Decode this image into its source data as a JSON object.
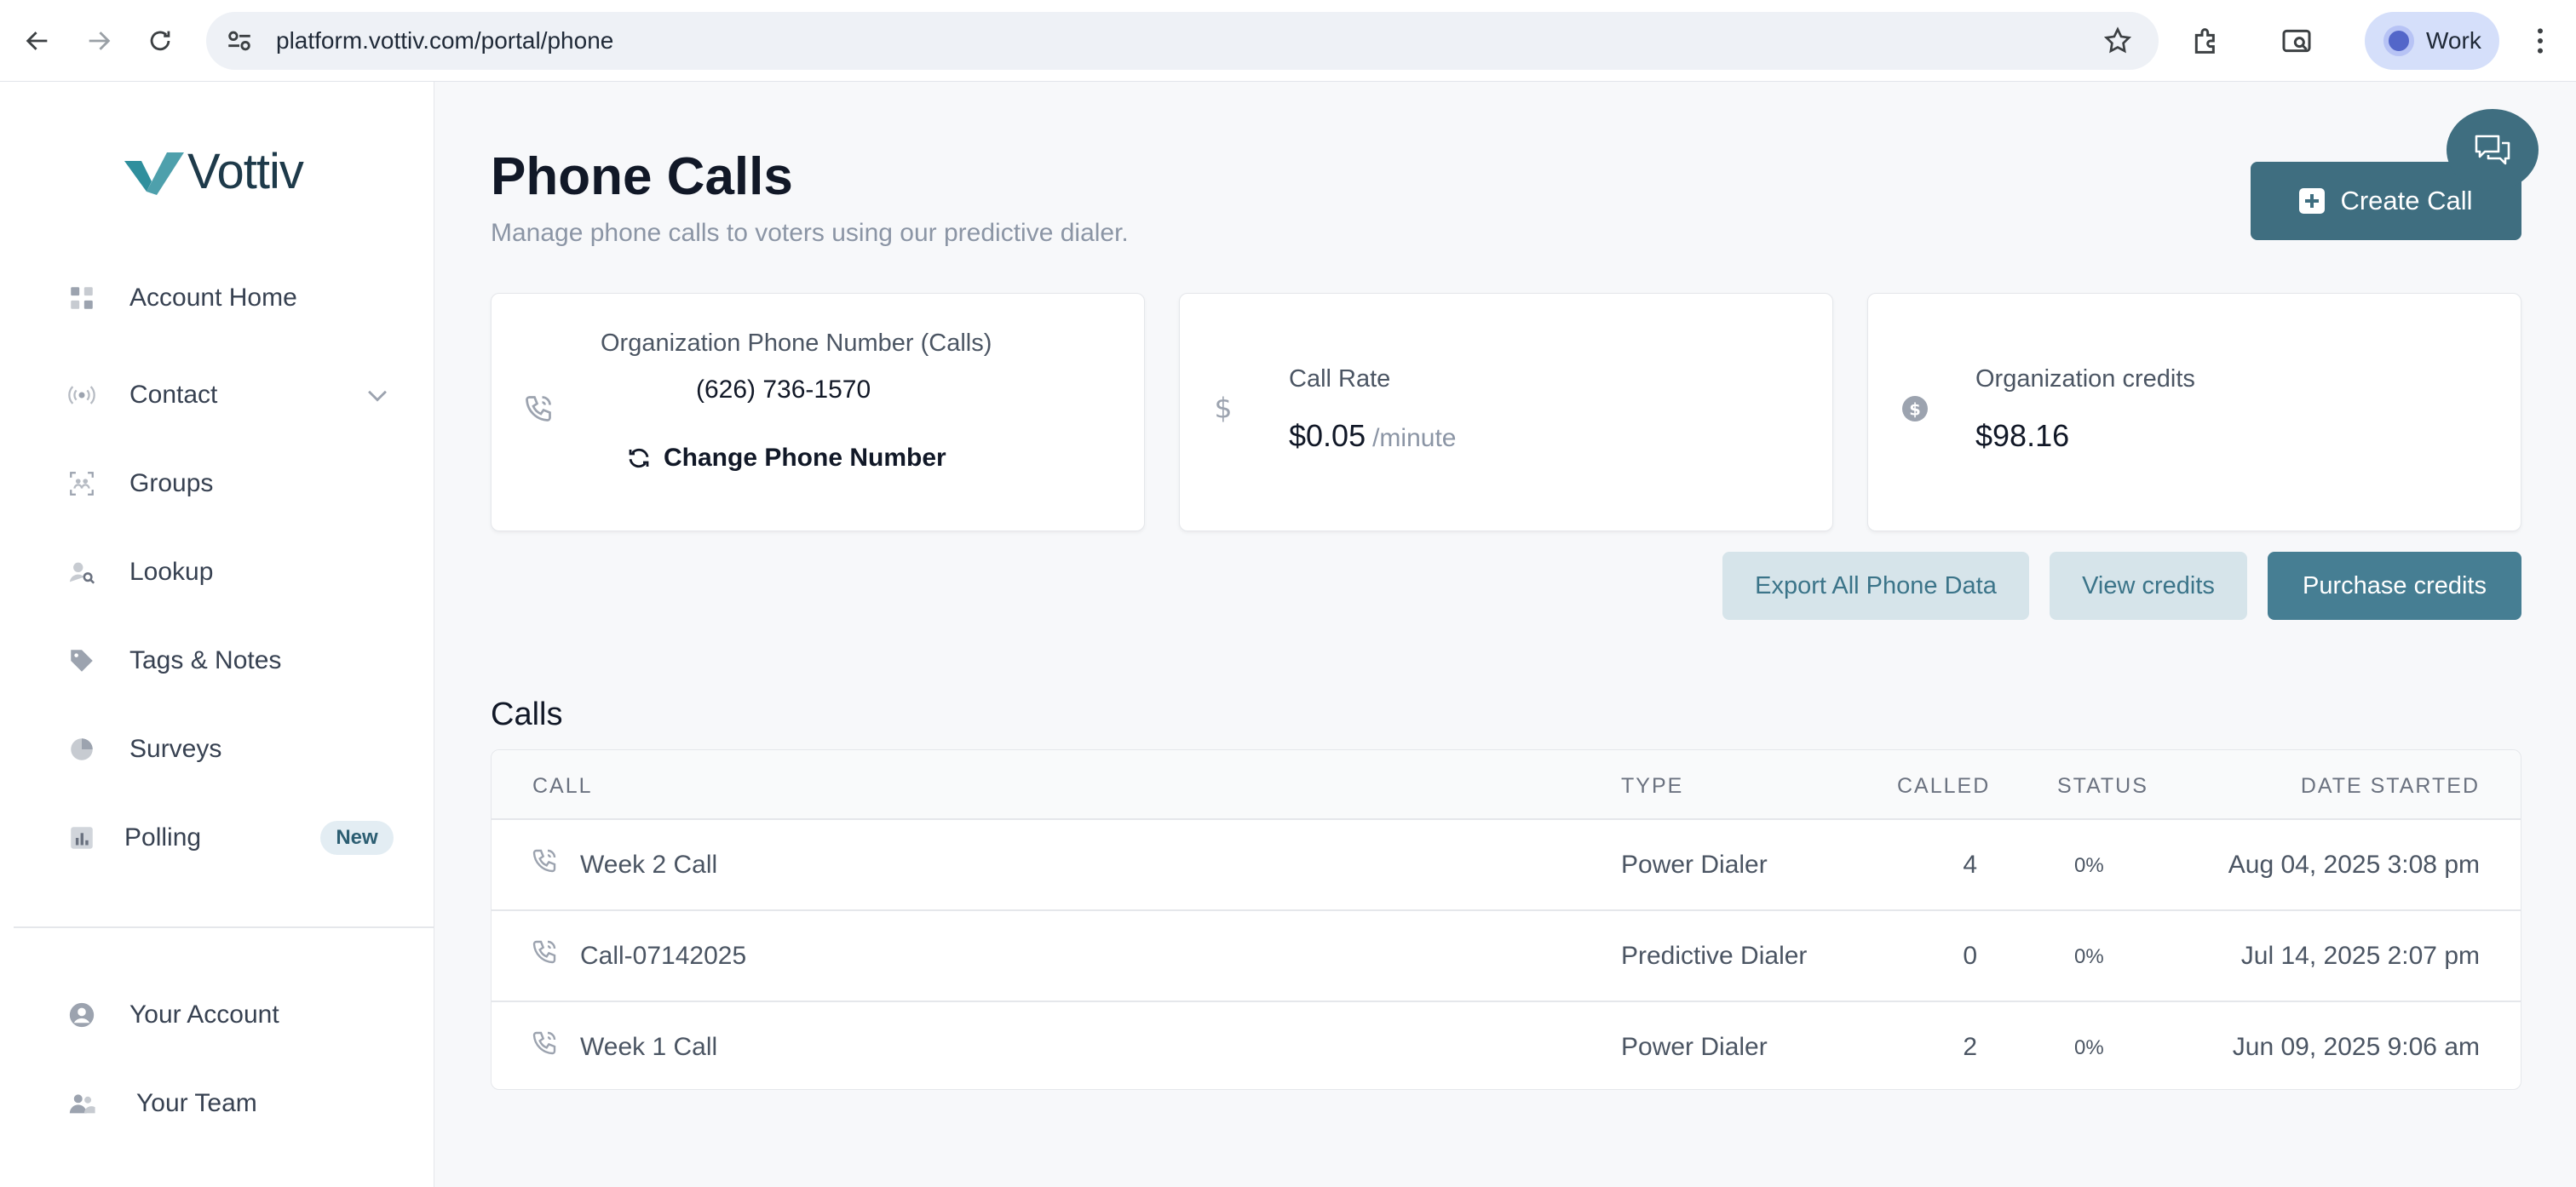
{
  "browser": {
    "url": "platform.vottiv.com/portal/phone",
    "profile_label": "Work"
  },
  "sidebar": {
    "logo_text": "Vottiv",
    "items": [
      {
        "label": "Account Home",
        "icon": "grid-icon"
      },
      {
        "label": "Contact",
        "icon": "broadcast-icon"
      },
      {
        "label": "Groups",
        "icon": "group-scan-icon"
      },
      {
        "label": "Lookup",
        "icon": "user-search-icon"
      },
      {
        "label": "Tags & Notes",
        "icon": "tag-icon"
      },
      {
        "label": "Surveys",
        "icon": "pie-icon"
      },
      {
        "label": "Polling",
        "icon": "bar-chart-icon",
        "badge": "New"
      }
    ],
    "bottom_items": [
      {
        "label": "Your Account",
        "icon": "user-circle-icon"
      },
      {
        "label": "Your Team",
        "icon": "team-icon"
      }
    ]
  },
  "main": {
    "title": "Phone Calls",
    "subtitle": "Manage phone calls to voters using our predictive dialer.",
    "create_button": "Create Call",
    "cards": {
      "phone": {
        "label": "Organization Phone Number (Calls)",
        "value": "(626) 736-1570",
        "action": "Change Phone Number"
      },
      "rate": {
        "label": "Call Rate",
        "value": "$0.05",
        "unit": "/minute"
      },
      "credits": {
        "label": "Organization credits",
        "value": "$98.16"
      }
    },
    "actions": {
      "export": "Export All Phone Data",
      "view_credits": "View credits",
      "purchase_credits": "Purchase credits"
    },
    "calls_section_title": "Calls",
    "table": {
      "headers": {
        "call": "CALL",
        "type": "TYPE",
        "called": "CALLED",
        "status": "STATUS",
        "date_started": "DATE STARTED"
      },
      "rows": [
        {
          "call": "Week 2 Call",
          "type": "Power Dialer",
          "called": "4",
          "status": "0%",
          "date_started": "Aug 04, 2025 3:08 pm"
        },
        {
          "call": "Call-07142025",
          "type": "Predictive Dialer",
          "called": "0",
          "status": "0%",
          "date_started": "Jul 14, 2025 2:07 pm"
        },
        {
          "call": "Week 1 Call",
          "type": "Power Dialer",
          "called": "2",
          "status": "0%",
          "date_started": "Jun 09, 2025 9:06 am"
        }
      ]
    }
  },
  "colors": {
    "brand_dark": "#3f6e80",
    "brand_button": "#467e93",
    "brand_light": "#d6e4ea",
    "logo_teal": "#2f8f9d"
  }
}
